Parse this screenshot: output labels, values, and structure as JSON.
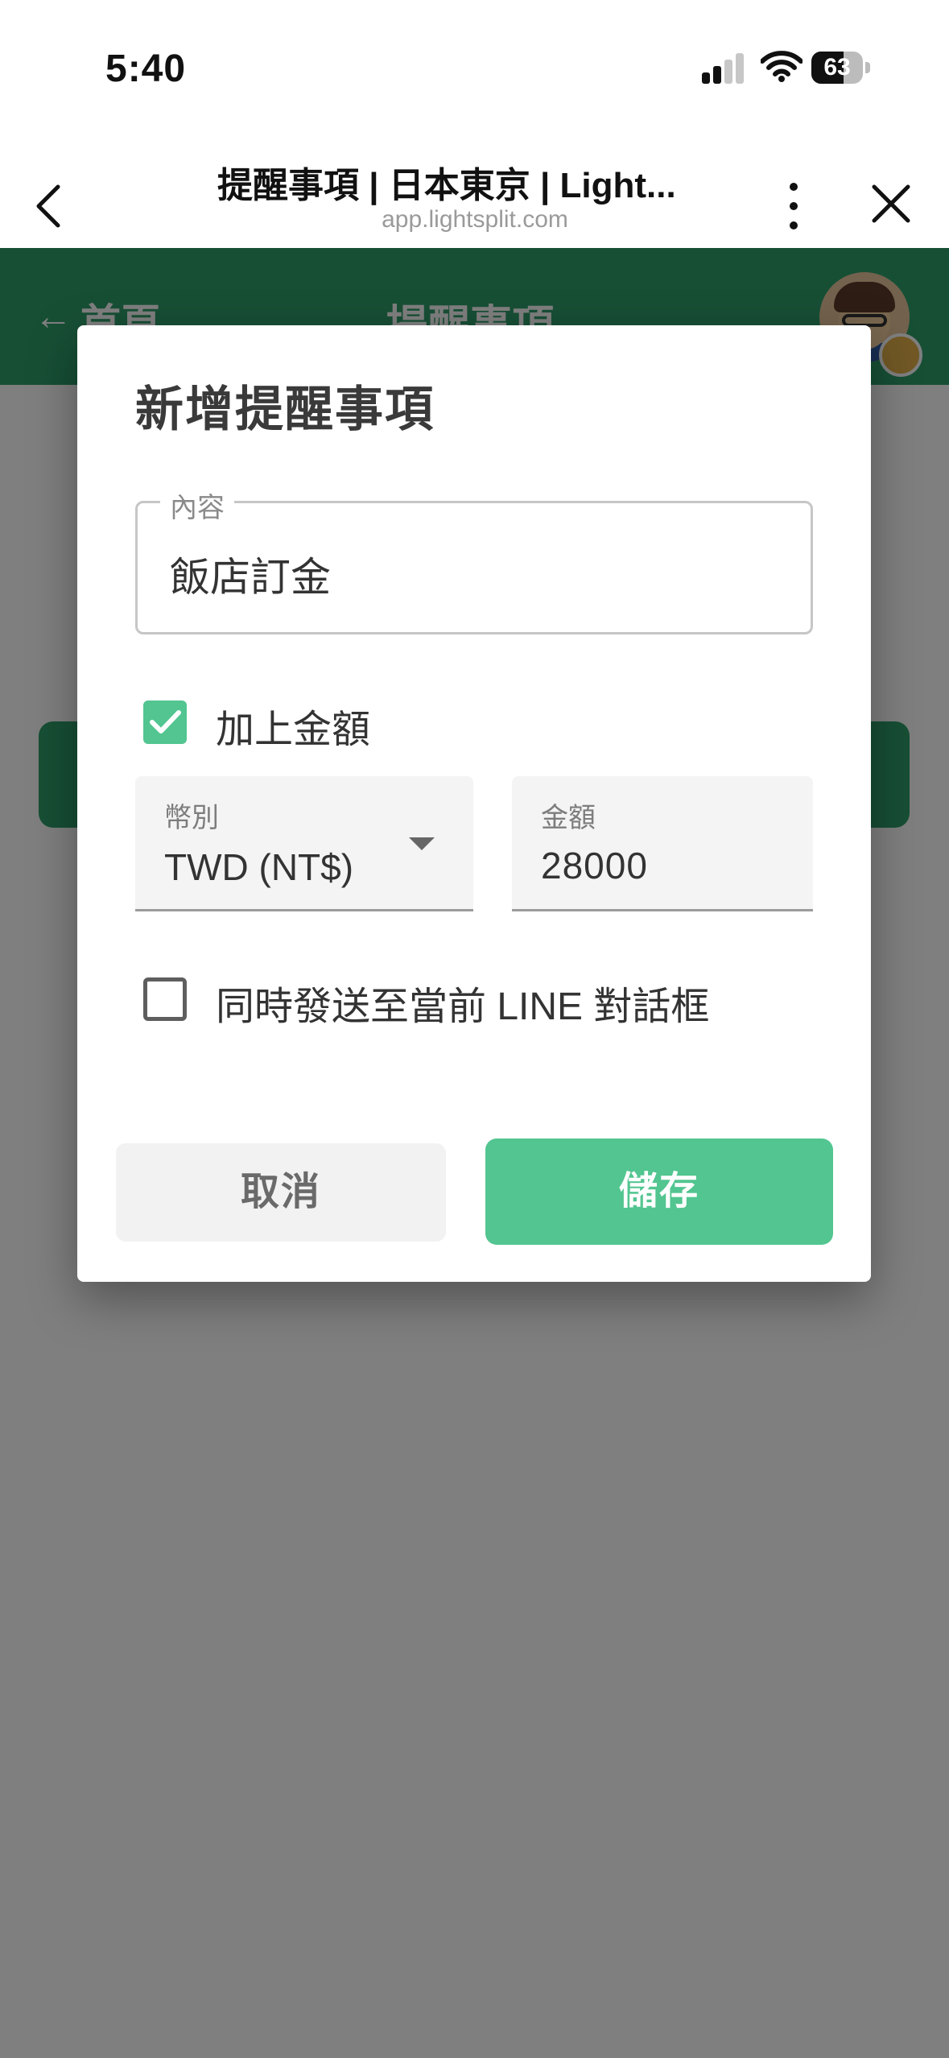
{
  "status_bar": {
    "time": "5:40",
    "battery": "63",
    "battery_level": 0.63
  },
  "browser": {
    "title": "提醒事項 | 日本東京 | Light...",
    "url": "app.lightsplit.com"
  },
  "app_header": {
    "back_label": "首頁",
    "title": "提醒事項",
    "color": "#2f9e6b"
  },
  "dialog": {
    "title": "新增提醒事項",
    "content_field": {
      "label": "內容",
      "value": "飯店訂金"
    },
    "add_amount": {
      "label": "加上金額",
      "checked": true
    },
    "currency": {
      "label": "幣別",
      "value": "TWD (NT$)"
    },
    "amount": {
      "label": "金額",
      "value": "28000"
    },
    "send_line": {
      "label": "同時發送至當前 LINE 對話框",
      "checked": false
    },
    "cancel_label": "取消",
    "save_label": "儲存",
    "accent_color": "#52c590"
  }
}
